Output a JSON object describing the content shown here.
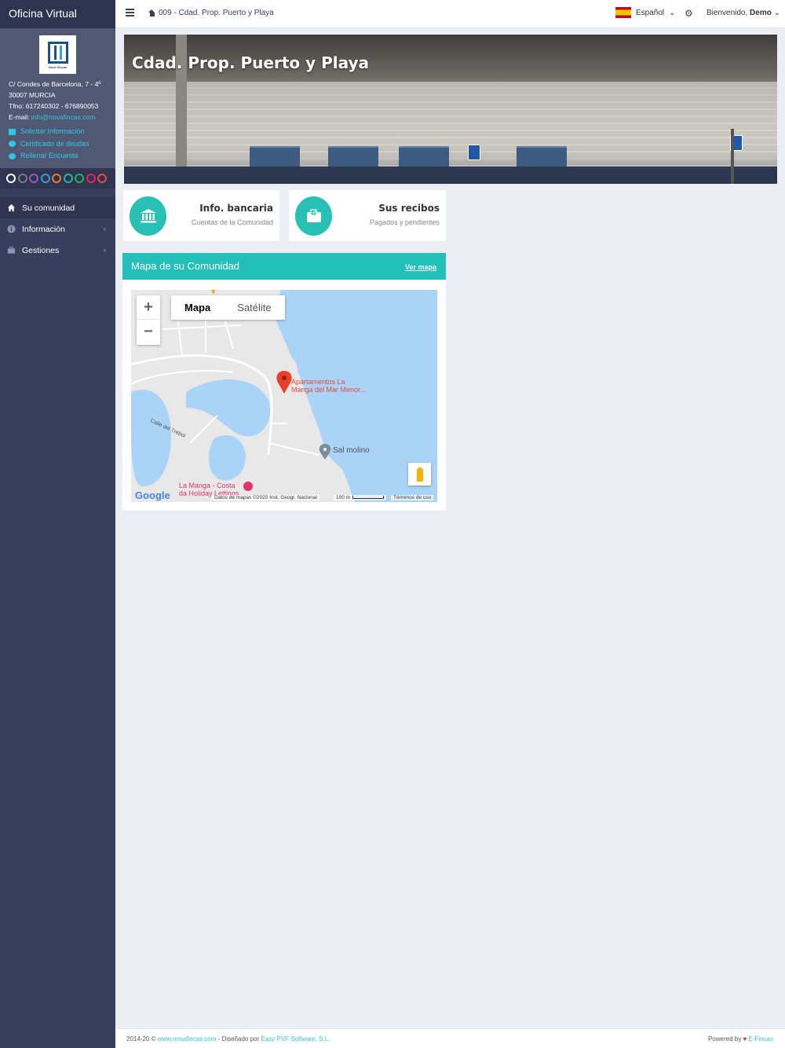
{
  "sidebar": {
    "brand": "Oficina Virtual",
    "logo_text": "Nova Fincas",
    "address_line1": "C/ Condes de Barcelona, 7 - 4º",
    "address_line2": "30007 MURCIA",
    "phone": "Tfno: 617240302 - 676890053",
    "email_label": "E-mail:",
    "email": "info@novafincas.com",
    "links": [
      {
        "label": "Solicitar Información",
        "icon": "envelope-icon"
      },
      {
        "label": "Certificado de deudas",
        "icon": "certificate-icon"
      },
      {
        "label": "Rellenar Encuesta",
        "icon": "survey-icon"
      }
    ],
    "theme_colors": [
      "#ffffff",
      "#7a7a7a",
      "#9b59b6",
      "#3498db",
      "#e67e22",
      "#1abc9c",
      "#27ae60",
      "#e91e63",
      "#e74c3c"
    ],
    "menu": [
      {
        "label": "Su comunidad",
        "icon": "home-icon",
        "active": true
      },
      {
        "label": "Información",
        "icon": "info-icon",
        "caret": "‹"
      },
      {
        "label": "Gestiones",
        "icon": "briefcase-icon",
        "caret": "‹"
      }
    ]
  },
  "topbar": {
    "breadcrumb": "009 - Cdad. Prop. Puerto y Playa",
    "language": "Español",
    "welcome_prefix": "Bienvenido,",
    "user": "Demo"
  },
  "hero": {
    "title": "Cdad. Prop. Puerto y Playa"
  },
  "cards": [
    {
      "title": "Info. bancaria",
      "subtitle": "Cuentas de la Comunidad",
      "icon": "bank-icon"
    },
    {
      "title": "Sus recibos",
      "subtitle": "Pagados y pendientes",
      "icon": "wallet-icon"
    }
  ],
  "map_panel": {
    "title": "Mapa de su Comunidad",
    "link": "Ver mapa",
    "map_type_map": "Mapa",
    "map_type_satellite": "Satélite",
    "zoom_in": "+",
    "zoom_out": "−",
    "marker_label_1": "Apartamentos La",
    "marker_label_2": "Manga del Mar Menor...",
    "poi_label": "Sal molino",
    "street_label": "Calle del Trébol",
    "hotel_label_1": "La Manga - Costa",
    "hotel_label_2": "da Holiday Lettings",
    "google": "Google",
    "attribution": "Datos de mapas ©2020 Inst. Geogr. Nacional",
    "scale": "100 m",
    "terms": "Términos de uso"
  },
  "footer": {
    "left_prefix": "2014-20 ©",
    "left_link": "www.novafincas.com",
    "left_mid": "- Diseñado por",
    "left_link2": "Easy PVF Software, S.L.",
    "right_prefix": "Powered by",
    "right_link": "E-Fincas"
  }
}
